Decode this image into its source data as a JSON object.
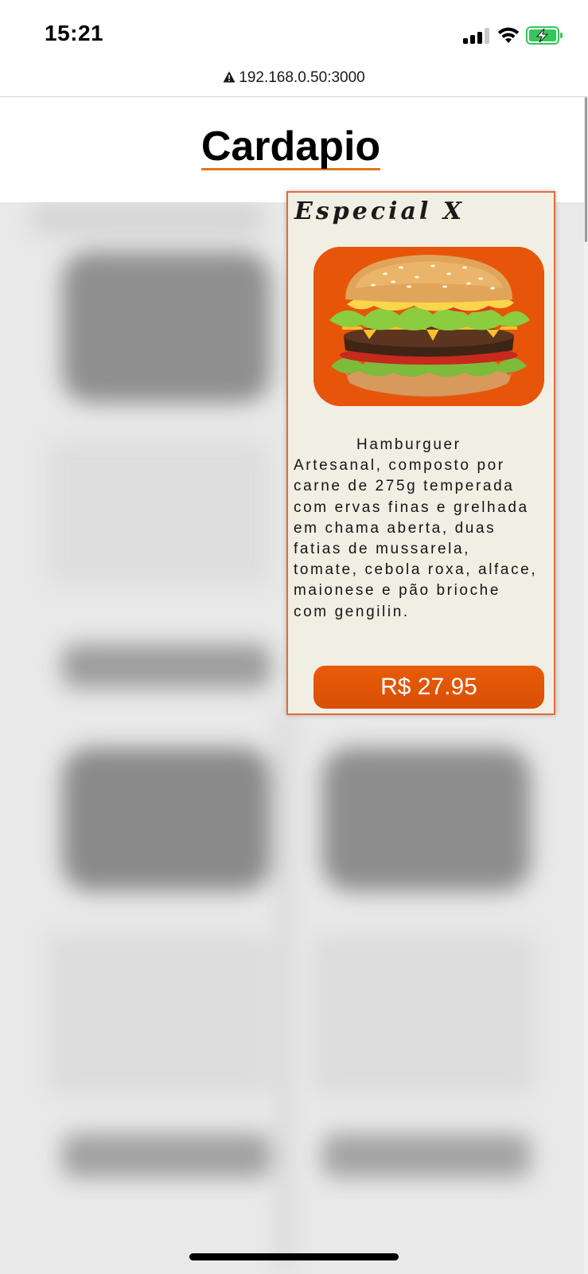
{
  "status_bar": {
    "time": "15:21",
    "icons": [
      "signal-icon",
      "wifi-icon",
      "battery-charging-icon"
    ]
  },
  "browser": {
    "url": "192.168.0.50:3000",
    "security_icon": "warning-icon"
  },
  "page": {
    "title": "Cardapio"
  },
  "product_card": {
    "name": "Especial X",
    "image": "hamburger-photo",
    "description": "Hamburguer\nArtesanal, composto por\ncarne de 275g temperada\ncom ervas finas e grelhada\nem chama aberta, duas\nfatias de mussarela,\ntomate, cebola roxa, alface,\nmaionese e pão brioche\ncom gengilin.",
    "price": "R$ 27.95"
  },
  "colors": {
    "accent": "#e85b09",
    "card_background": "#f1eee3",
    "card_border": "#e16b3c",
    "title_underline": "#e1761d"
  }
}
